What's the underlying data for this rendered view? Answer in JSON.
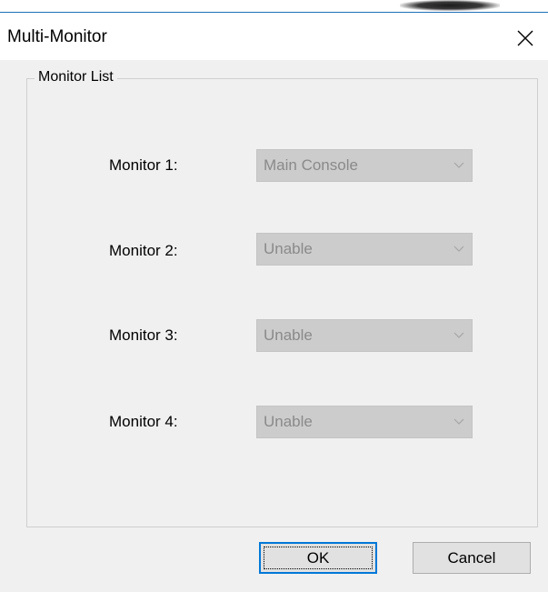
{
  "window": {
    "title": "Multi-Monitor"
  },
  "group": {
    "legend": "Monitor List"
  },
  "monitors": [
    {
      "label": "Monitor 1:",
      "value": "Main Console",
      "enabled": false
    },
    {
      "label": "Monitor 2:",
      "value": "Unable",
      "enabled": false
    },
    {
      "label": "Monitor 3:",
      "value": "Unable",
      "enabled": false
    },
    {
      "label": "Monitor 4:",
      "value": "Unable",
      "enabled": false
    }
  ],
  "buttons": {
    "ok_label": "OK",
    "cancel_label": "Cancel"
  },
  "colors": {
    "window_bg": "#f0f0f0",
    "disabled_combo_bg": "#cccccc",
    "disabled_text": "#8a8a8a",
    "focus_border": "#0078d7"
  },
  "icons": {
    "close": "close-icon",
    "dropdown": "chevron-down-icon"
  }
}
